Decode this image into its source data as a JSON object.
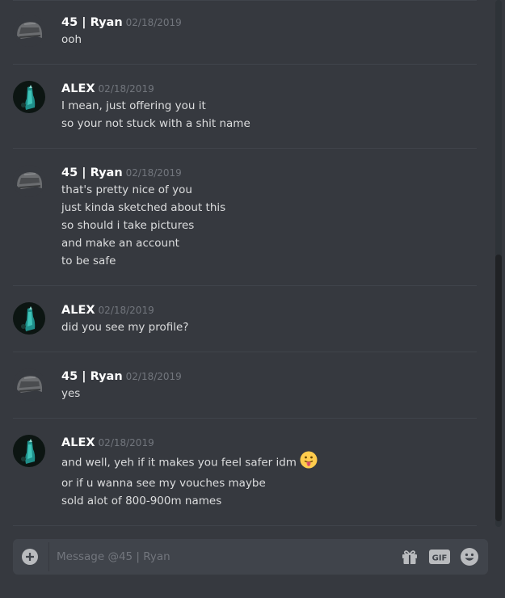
{
  "messages": [
    {
      "author": "45 | Ryan",
      "avatar": "helmet-avatar",
      "timestamp": "02/18/2019",
      "lines": [
        "ooh"
      ]
    },
    {
      "author": "ALEX",
      "avatar": "alex-avatar",
      "timestamp": "02/18/2019",
      "lines": [
        "I mean, just offering you it",
        "so your not stuck with a shit name"
      ]
    },
    {
      "author": "45 | Ryan",
      "avatar": "helmet-avatar",
      "timestamp": "02/18/2019",
      "lines": [
        "that's pretty nice of you",
        "just kinda sketched about this",
        "so should i take pictures",
        "and make an account",
        "to be safe"
      ]
    },
    {
      "author": "ALEX",
      "avatar": "alex-avatar",
      "timestamp": "02/18/2019",
      "lines": [
        "did you see my profile?"
      ]
    },
    {
      "author": "45 | Ryan",
      "avatar": "helmet-avatar",
      "timestamp": "02/18/2019",
      "lines": [
        "yes"
      ]
    },
    {
      "author": "ALEX",
      "avatar": "alex-avatar",
      "timestamp": "02/18/2019",
      "lines": [
        "and well, yeh if it makes you feel safer idm",
        "or if u wanna see my vouches maybe",
        "sold alot of 800-900m names"
      ],
      "emoji": "tongue-out-emoji"
    }
  ],
  "composer": {
    "placeholder": "Message @45 | Ryan",
    "attach_icon": "plus-circle-icon",
    "gift_icon": "gift-icon",
    "gif_icon": "gif-icon",
    "emoji_icon": "smiley-icon"
  }
}
